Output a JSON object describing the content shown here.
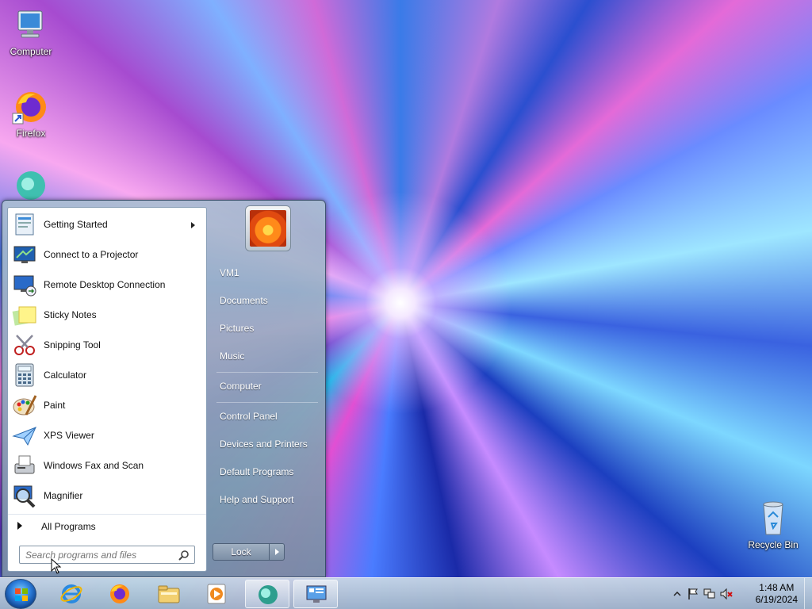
{
  "desktop": {
    "icons": [
      {
        "label": "Computer"
      },
      {
        "label": "Firefox"
      },
      {
        "label": ""
      },
      {
        "label": "Recycle Bin"
      }
    ]
  },
  "start_menu": {
    "programs": [
      {
        "label": "Getting Started",
        "icon": "getting-started-icon",
        "has_submenu": true
      },
      {
        "label": "Connect to a Projector",
        "icon": "projector-icon"
      },
      {
        "label": "Remote Desktop Connection",
        "icon": "remote-desktop-icon"
      },
      {
        "label": "Sticky Notes",
        "icon": "sticky-notes-icon"
      },
      {
        "label": "Snipping Tool",
        "icon": "scissors-icon"
      },
      {
        "label": "Calculator",
        "icon": "calculator-icon"
      },
      {
        "label": "Paint",
        "icon": "paint-palette-icon"
      },
      {
        "label": "XPS Viewer",
        "icon": "paper-plane-icon"
      },
      {
        "label": "Windows Fax and Scan",
        "icon": "fax-icon"
      },
      {
        "label": "Magnifier",
        "icon": "magnifier-icon"
      }
    ],
    "all_programs_label": "All Programs",
    "search": {
      "placeholder": "Search programs and files"
    },
    "right_items": [
      {
        "label": "VM1"
      },
      {
        "label": "Documents"
      },
      {
        "label": "Pictures"
      },
      {
        "label": "Music"
      },
      {
        "label": "Computer"
      },
      {
        "label": "Control Panel"
      },
      {
        "label": "Devices and Printers"
      },
      {
        "label": "Default Programs"
      },
      {
        "label": "Help and Support"
      }
    ],
    "shutdown": {
      "label": "Lock"
    }
  },
  "taskbar": {
    "pinned": [
      {
        "name": "internet-explorer-icon"
      },
      {
        "name": "firefox-icon"
      },
      {
        "name": "windows-explorer-icon"
      },
      {
        "name": "media-player-icon"
      },
      {
        "name": "app-icon"
      },
      {
        "name": "control-panel-icon"
      }
    ],
    "clock": {
      "time": "1:48 AM",
      "date": "6/19/2024"
    }
  },
  "colors": {
    "accent": "#2a7ad8",
    "taskbar": "#b4c8dc"
  }
}
